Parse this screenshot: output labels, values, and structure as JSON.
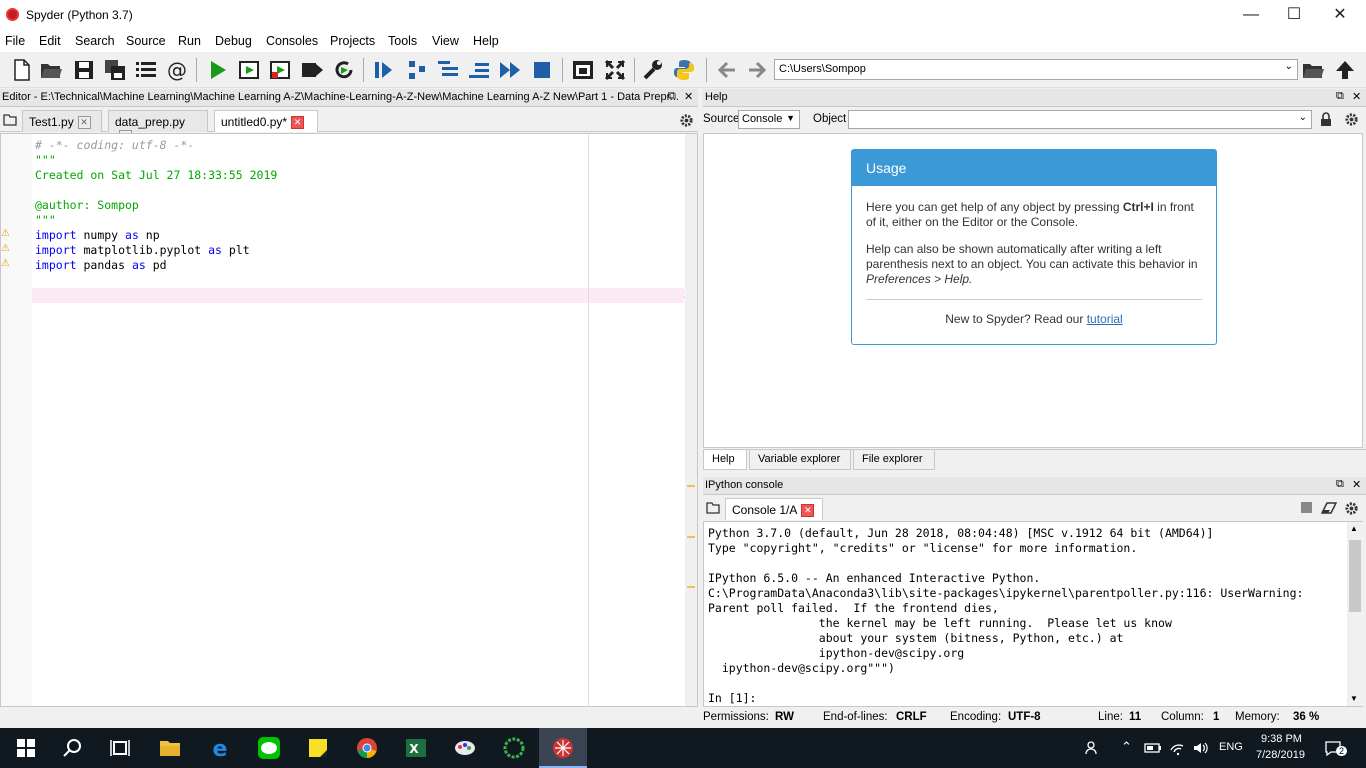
{
  "window": {
    "title": "Spyder (Python 3.7)",
    "minimize": "—",
    "maximize": "☐",
    "close": "✕"
  },
  "menu": [
    "File",
    "Edit",
    "Search",
    "Source",
    "Run",
    "Debug",
    "Consoles",
    "Projects",
    "Tools",
    "View",
    "Help"
  ],
  "path": {
    "value": "C:\\Users\\Sompop"
  },
  "editor": {
    "header": "Editor - E:\\Technical\\Machine Learning\\Machine Learning A-Z\\Machine-Learning-A-Z-New\\Machine Learning A-Z New\\Part 1 - Data Prepr...",
    "tabs": [
      "Test1.py",
      "data_prep.py",
      "untitled0.py*"
    ],
    "line_numbers": [
      "1",
      "2",
      "3",
      "4",
      "5",
      "6",
      "7",
      "8",
      "9",
      "10",
      "11"
    ],
    "lines": {
      "l1": "# -*- coding: utf-8 -*-",
      "l2": "\"\"\"",
      "l3": "Created on Sat Jul 27 18:33:55 2019",
      "l5": "@author: Sompop",
      "l6": "\"\"\"",
      "l7a": "import",
      "l7b": " numpy ",
      "l7c": "as",
      "l7d": " np",
      "l8a": "import",
      "l8b": " matplotlib.pyplot ",
      "l8c": "as",
      "l8d": " plt",
      "l9a": "import",
      "l9b": " pandas ",
      "l9c": "as",
      "l9d": " pd"
    }
  },
  "help": {
    "header": "Help",
    "source_label": "Source",
    "source_value": "Console",
    "object_label": "Object",
    "usage_title": "Usage",
    "p1a": "Here you can get help of any object by pressing ",
    "p1b": "Ctrl+I",
    "p1c": " in front of it, either on the Editor or the Console.",
    "p2a": "Help can also be shown automatically after writing a left parenthesis next to an object. You can activate this behavior in ",
    "p2b": "Preferences > Help.",
    "new_text": "New to Spyder? Read our ",
    "tutorial": "tutorial",
    "tabs": [
      "Help",
      "Variable explorer",
      "File explorer"
    ]
  },
  "ipython": {
    "header": "IPython console",
    "tab": "Console 1/A",
    "output": "Python 3.7.0 (default, Jun 28 2018, 08:04:48) [MSC v.1912 64 bit (AMD64)]\nType \"copyright\", \"credits\" or \"license\" for more information.\n\nIPython 6.5.0 -- An enhanced Interactive Python.\nC:\\ProgramData\\Anaconda3\\lib\\site-packages\\ipykernel\\parentpoller.py:116: UserWarning:\nParent poll failed.  If the frontend dies,\n                the kernel may be left running.  Please let us know\n                about your system (bitness, Python, etc.) at\n                ipython-dev@scipy.org\n  ipython-dev@scipy.org\"\"\")\n\nIn [1]:"
  },
  "status": {
    "perm_label": "Permissions:",
    "perm": "RW",
    "eol_label": "End-of-lines:",
    "eol": "CRLF",
    "enc_label": "Encoding:",
    "enc": "UTF-8",
    "line_label": "Line:",
    "line": "11",
    "col_label": "Column:",
    "col": "1",
    "mem_label": "Memory:",
    "mem": "36 %"
  },
  "taskbar": {
    "lang": "ENG",
    "time": "9:38 PM",
    "date": "7/28/2019",
    "notif": "2"
  }
}
